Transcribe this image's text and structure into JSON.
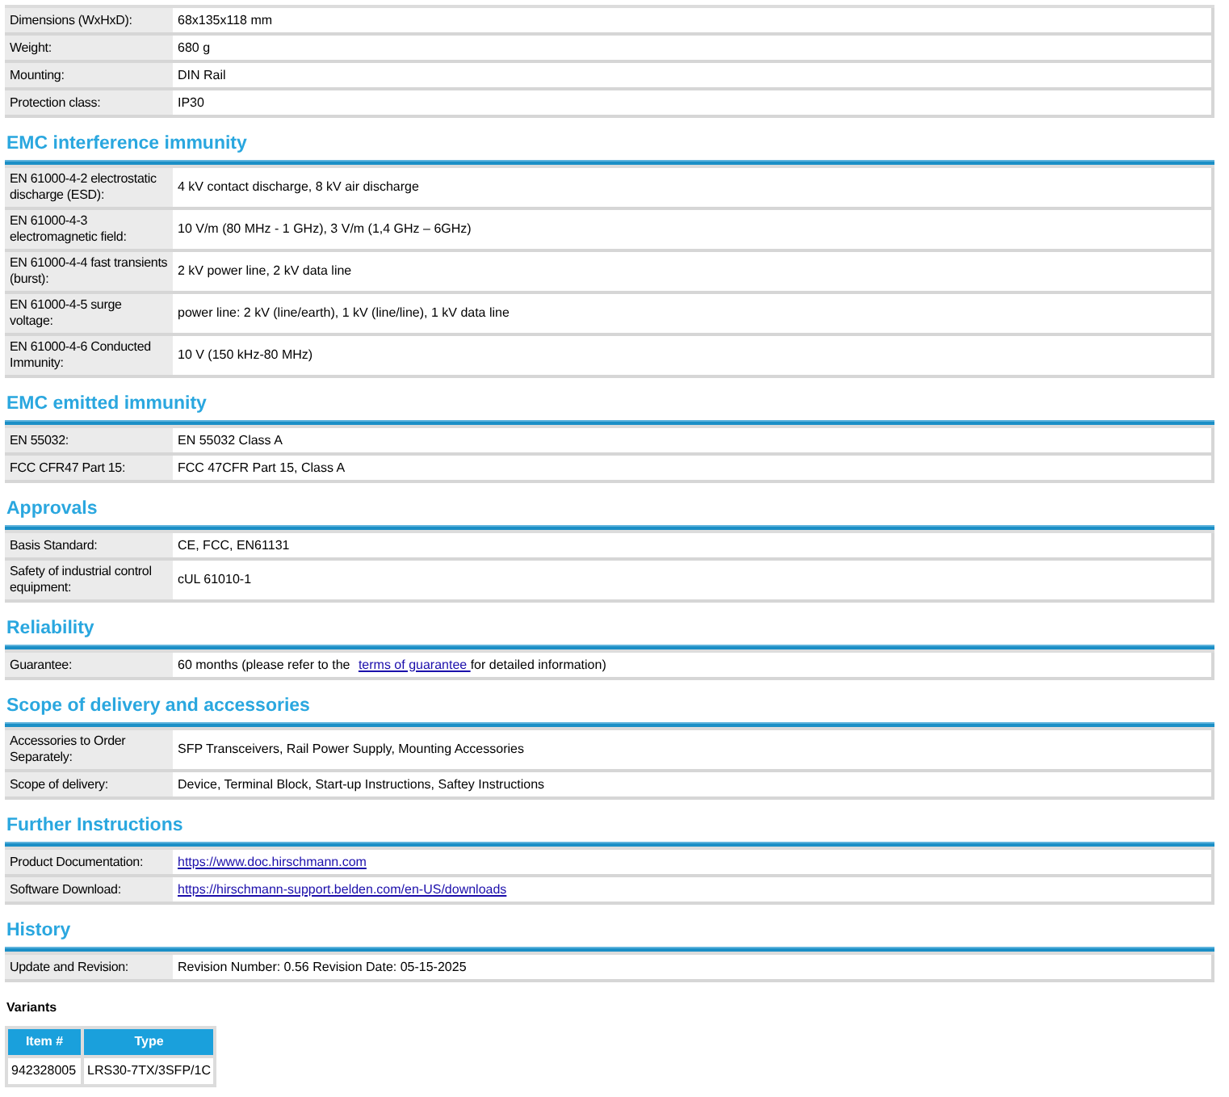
{
  "sections": [
    {
      "rows": [
        {
          "label": "Dimensions (WxHxD):",
          "value": "68x135x118 mm"
        },
        {
          "label": "Weight:",
          "value": "680 g"
        },
        {
          "label": "Mounting:",
          "value": "DIN Rail"
        },
        {
          "label": "Protection class:",
          "value": "IP30"
        }
      ]
    },
    {
      "heading": "EMC interference immunity",
      "rows": [
        {
          "label": "EN 61000-4-2 electrostatic discharge (ESD):",
          "value": "4 kV contact discharge, 8 kV air discharge"
        },
        {
          "label": "EN 61000-4-3 electromagnetic field:",
          "value": "10 V/m (80 MHz - 1 GHz), 3 V/m (1,4 GHz – 6GHz)"
        },
        {
          "label": "EN 61000-4-4 fast transients (burst):",
          "value": "2 kV power line, 2 kV data line"
        },
        {
          "label": "EN 61000-4-5 surge voltage:",
          "value": "power line: 2 kV (line/earth), 1 kV (line/line), 1 kV data line"
        },
        {
          "label": "EN 61000-4-6 Conducted Immunity:",
          "value": "10 V (150 kHz-80 MHz)"
        }
      ]
    },
    {
      "heading": "EMC emitted immunity",
      "rows": [
        {
          "label": "EN 55032:",
          "value": "EN 55032 Class A"
        },
        {
          "label": "FCC CFR47 Part 15:",
          "value": "FCC 47CFR Part 15, Class A"
        }
      ]
    },
    {
      "heading": "Approvals",
      "rows": [
        {
          "label": "Basis Standard:",
          "value": "CE, FCC, EN61131"
        },
        {
          "label": "Safety of industrial control equipment:",
          "value": "cUL 61010-1"
        }
      ]
    },
    {
      "heading": "Reliability",
      "rows": [
        {
          "label": "Guarantee:",
          "parts": [
            {
              "text": "60 months (please refer to the "
            },
            {
              "text": "terms of guarantee ",
              "kind": "link"
            },
            {
              "text": "for detailed information)"
            }
          ]
        }
      ]
    },
    {
      "heading": "Scope of delivery and accessories",
      "rows": [
        {
          "label": "Accessories to Order Separately:",
          "value": "SFP Transceivers, Rail Power Supply, Mounting Accessories"
        },
        {
          "label": "Scope of delivery:",
          "value": "Device, Terminal Block, Start-up Instructions, Saftey Instructions"
        }
      ]
    },
    {
      "heading": "Further Instructions",
      "rows": [
        {
          "label": "Product Documentation:",
          "value": "https://www.doc.hirschmann.com",
          "kind": "link"
        },
        {
          "label": "Software Download:",
          "value": "https://hirschmann-support.belden.com/en-US/downloads",
          "kind": "link"
        }
      ]
    },
    {
      "heading": "History",
      "rows": [
        {
          "label": "Update and Revision:",
          "value": "Revision Number: 0.56 Revision Date: 05-15-2025"
        }
      ]
    }
  ],
  "variants": {
    "title": "Variants",
    "columns": [
      "Item #",
      "Type"
    ],
    "rows": [
      [
        "942328005",
        "LRS30-7TX/3SFP/1C"
      ]
    ]
  }
}
